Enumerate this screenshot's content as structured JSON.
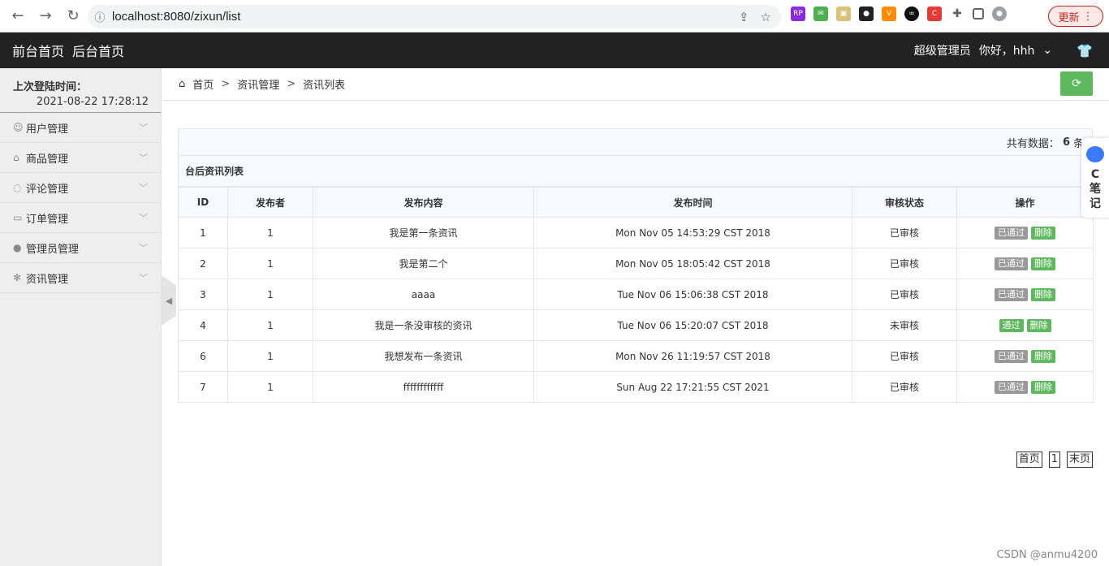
{
  "browser": {
    "url": "localhost:8080/zixun/list",
    "update_label": "更新",
    "back_glyph": "←",
    "forward_glyph": "→",
    "reload_glyph": "↻",
    "update_glyph": "⋮"
  },
  "header": {
    "nav": [
      "前台首页",
      "后台首页"
    ],
    "role": "超级管理员",
    "greeting": "你好，hhh"
  },
  "sidebar": {
    "login_label": "上次登陆时间：",
    "login_time": "2021-08-22 17:28:12",
    "items": [
      {
        "label": "用户管理",
        "icon": "user-icon"
      },
      {
        "label": "商品管理",
        "icon": "bag-icon"
      },
      {
        "label": "评论管理",
        "icon": "comment-icon"
      },
      {
        "label": "订单管理",
        "icon": "order-icon"
      },
      {
        "label": "管理员管理",
        "icon": "admin-icon"
      },
      {
        "label": "资讯管理",
        "icon": "gear-icon"
      }
    ]
  },
  "breadcrumb": {
    "items": [
      "首页",
      "资讯管理",
      "资讯列表"
    ],
    "separator": ">"
  },
  "table": {
    "total_label": "共有数据：",
    "total_count": "6",
    "total_unit": "条",
    "caption": "台后资讯列表",
    "columns": [
      "ID",
      "发布者",
      "发布内容",
      "发布时间",
      "审核状态",
      "操作"
    ],
    "rows": [
      {
        "id": "1",
        "publisher": "1",
        "content": "我是第一条资讯",
        "time": "Mon Nov 05 14:53:29 CST 2018",
        "status": "已审核",
        "action": "已通过",
        "action_type": "gray",
        "delete": "删除"
      },
      {
        "id": "2",
        "publisher": "1",
        "content": "我是第二个",
        "time": "Mon Nov 05 18:05:42 CST 2018",
        "status": "已审核",
        "action": "已通过",
        "action_type": "gray",
        "delete": "删除"
      },
      {
        "id": "3",
        "publisher": "1",
        "content": "aaaa",
        "time": "Tue Nov 06 15:06:38 CST 2018",
        "status": "已审核",
        "action": "已通过",
        "action_type": "gray",
        "delete": "删除"
      },
      {
        "id": "4",
        "publisher": "1",
        "content": "我是一条没审核的资讯",
        "time": "Tue Nov 06 15:20:07 CST 2018",
        "status": "未审核",
        "action": "通过",
        "action_type": "green",
        "delete": "删除"
      },
      {
        "id": "6",
        "publisher": "1",
        "content": "我想发布一条资讯",
        "time": "Mon Nov 26 11:19:57 CST 2018",
        "status": "已审核",
        "action": "已通过",
        "action_type": "gray",
        "delete": "删除"
      },
      {
        "id": "7",
        "publisher": "1",
        "content": "ffffffffffff",
        "time": "Sun Aug 22 17:21:55 CST 2021",
        "status": "已审核",
        "action": "已通过",
        "action_type": "gray",
        "delete": "删除"
      }
    ]
  },
  "pager": {
    "first": "首页",
    "page": "1",
    "last": "末页"
  },
  "side_widget": {
    "line1": "C",
    "line2": "笔",
    "line3": "记"
  },
  "watermark": "CSDN @anmu4200",
  "colors": {
    "accent_green": "#5eb95e",
    "header_bg": "#222222",
    "passed_gray": "#999999"
  }
}
